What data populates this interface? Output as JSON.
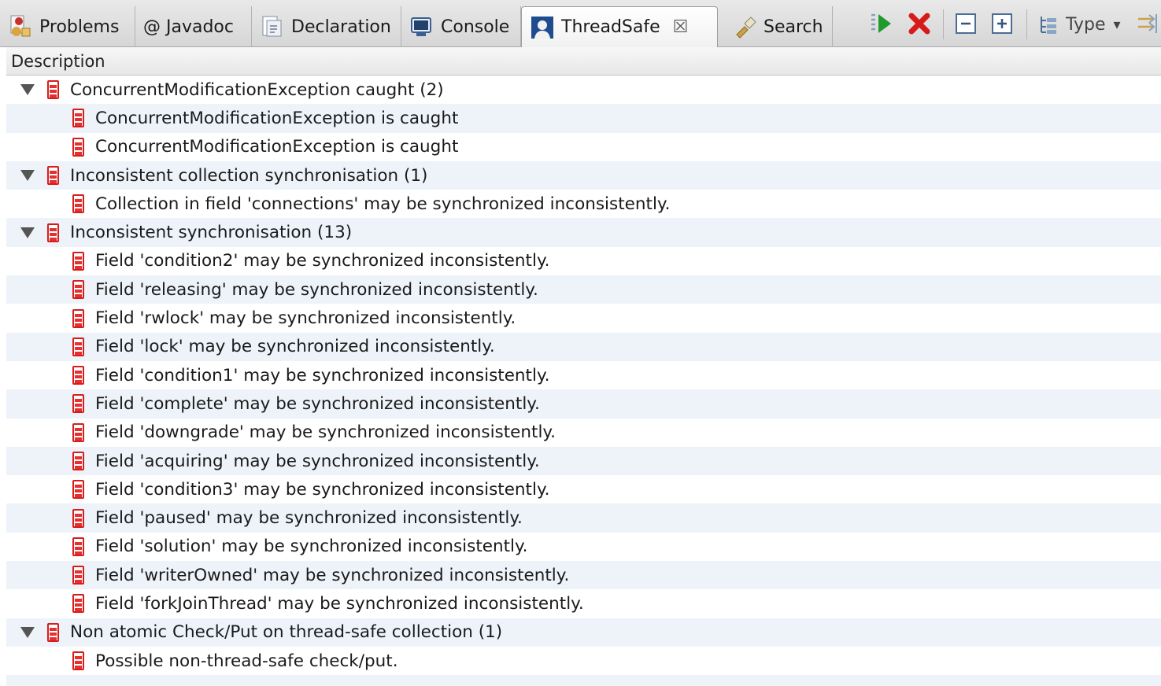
{
  "tabs": [
    {
      "label": "Problems",
      "icon": "problems-icon"
    },
    {
      "label": "@ Javadoc",
      "icon": "javadoc-icon"
    },
    {
      "label": "Declaration",
      "icon": "declaration-icon"
    },
    {
      "label": "Console",
      "icon": "console-icon"
    },
    {
      "label": "ThreadSafe",
      "icon": "threadsafe-icon",
      "active": true,
      "close_symbol": "☒"
    },
    {
      "label": "Search",
      "icon": "search-flashlight-icon"
    }
  ],
  "toolbar": {
    "run_icon": "run-icon",
    "stop_icon": "remove-icon",
    "collapse_icon": "collapse-all-icon",
    "expand_icon": "expand-all-icon",
    "type_label": "Type",
    "type_arrow": "▾",
    "pin_icon": "pin-icon"
  },
  "column_header": "Description",
  "tree": [
    {
      "label": "ConcurrentModificationException caught (2)",
      "children": [
        "ConcurrentModificationException is caught",
        "ConcurrentModificationException is caught"
      ]
    },
    {
      "label": "Inconsistent collection synchronisation (1)",
      "children": [
        "Collection in field 'connections' may be synchronized inconsistently."
      ]
    },
    {
      "label": "Inconsistent synchronisation (13)",
      "children": [
        "Field 'condition2' may be synchronized inconsistently.",
        "Field 'releasing' may be synchronized inconsistently.",
        "Field 'rwlock' may be synchronized inconsistently.",
        "Field 'lock' may be synchronized inconsistently.",
        "Field 'condition1' may be synchronized inconsistently.",
        "Field 'complete' may be synchronized inconsistently.",
        "Field 'downgrade' may be synchronized inconsistently.",
        "Field 'acquiring' may be synchronized inconsistently.",
        "Field 'condition3' may be synchronized inconsistently.",
        "Field 'paused' may be synchronized inconsistently.",
        "Field 'solution' may be synchronized inconsistently.",
        "Field 'writerOwned' may be synchronized inconsistently.",
        "Field 'forkJoinThread' may be synchronized inconsistently."
      ]
    },
    {
      "label": "Non atomic Check/Put on thread-safe collection (1)",
      "children": [
        "Possible non-thread-safe check/put."
      ]
    }
  ],
  "colors": {
    "error_red": "#d81c1c",
    "row_alt": "#eef3fa",
    "tab_active_bg": "#ffffff"
  }
}
